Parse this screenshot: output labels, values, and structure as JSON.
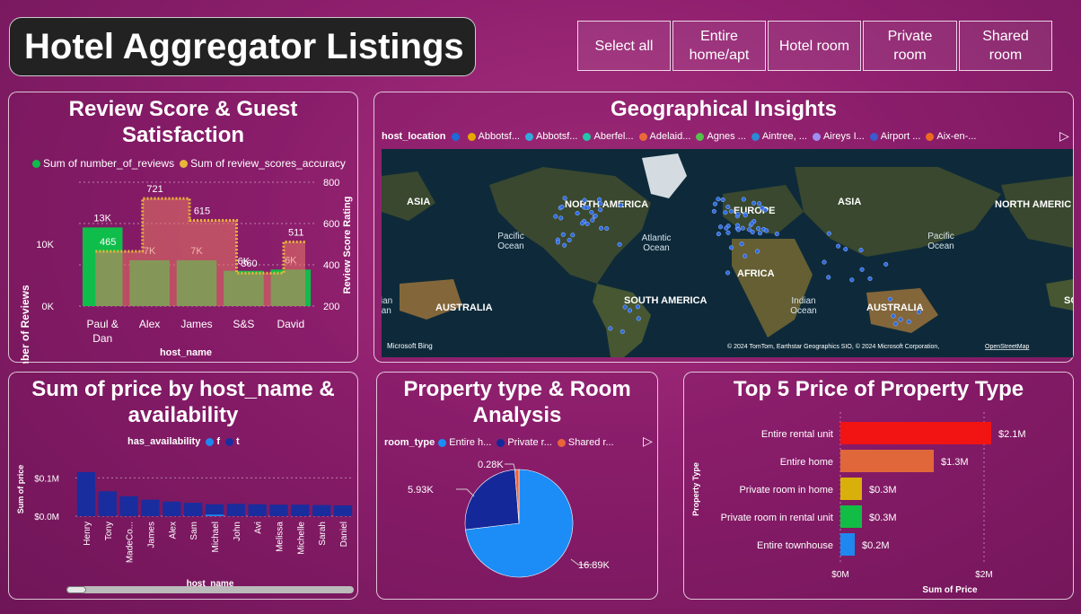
{
  "header": {
    "title": "Hotel Aggregator Listings"
  },
  "slicer": {
    "buttons": [
      "Select all",
      "Entire home/apt",
      "Hotel room",
      "Private room",
      "Shared room"
    ]
  },
  "review": {
    "title": "Review Score & Guest Satisfaction",
    "legend": [
      "Sum of number_of_reviews",
      "Sum of review_scores_accuracy"
    ],
    "ylabel_left": "Number of Reviews",
    "ylabel_right": "Review Score Rating",
    "xlabel": "host_name",
    "left_ticks": [
      "10K",
      "0K"
    ],
    "right_ticks": [
      "800",
      "600",
      "400",
      "200"
    ]
  },
  "geo": {
    "title": "Geographical Insights",
    "legend_label": "host_location",
    "legend_items": [
      "Abbotsf...",
      "Abbotsf...",
      "Aberfel...",
      "Adelaid...",
      "Agnes ...",
      "Aintree, ...",
      "Aireys I...",
      "Airport ...",
      "Aix-en-..."
    ],
    "legend_colors": [
      "#1e6ad8",
      "#e6a800",
      "#33aadd",
      "#22c5a8",
      "#e86a3a",
      "#55c04a",
      "#2a8ad6",
      "#9f8ff0",
      "#3c5acf",
      "#ef6a1e"
    ],
    "map_labels": {
      "asia_w": "ASIA",
      "north_america": "NORTH AMERICA",
      "europe": "EUROPE",
      "asia": "ASIA",
      "north_america_r": "NORTH AMERIC",
      "pacific_l": "Pacific\nOcean",
      "atlantic": "Atlantic\nOcean",
      "pacific_r": "Pacific\nOcean",
      "africa": "AFRICA",
      "south_america": "SOUTH AMERICA",
      "australia_l": "AUSTRALIA",
      "australia_r": "AUSTRALIA",
      "indian_l": "ndian\ncean",
      "indian": "Indian\nOcean",
      "so": "SO"
    },
    "bing": "Microsoft Bing",
    "copyright": "© 2024 TomTom, Earthstar Geographics SIO, © 2024 Microsoft Corporation,",
    "osm_link": "OpenStreetMap"
  },
  "price_host": {
    "title": "Sum of price by host_name & availability",
    "legend_label": "has_availability",
    "legend_items": [
      "f",
      "t"
    ],
    "ylabel": "Sum of price",
    "xlabel": "host_name",
    "yticks": [
      "$0.1M",
      "$0.0M"
    ]
  },
  "property": {
    "title": "Property type & Room Analysis",
    "legend_label": "room_type",
    "legend_items": [
      "Entire h...",
      "Private r...",
      "Shared r..."
    ],
    "labels": [
      "16.89K",
      "5.93K",
      "0.28K"
    ]
  },
  "top5": {
    "title": "Top 5 Price of Property Type",
    "ylabel": "Property Type",
    "xlabel": "Sum of Price",
    "xticks": [
      "$0M",
      "$2M"
    ]
  },
  "chart_data": [
    {
      "type": "bar",
      "title": "Review Score & Guest Satisfaction",
      "categories": [
        "Paul & Dan",
        "Alex",
        "James",
        "S&S",
        "David"
      ],
      "series": [
        {
          "name": "Sum of number_of_reviews",
          "values": [
            12700,
            7400,
            7400,
            5700,
            5900
          ],
          "labels": [
            "13K",
            "7K",
            "7K",
            "6K",
            "6K"
          ],
          "color": "#0fbd4a"
        },
        {
          "name": "Sum of review_scores_accuracy",
          "values": [
            465,
            721,
            615,
            360,
            511
          ],
          "color": "#e8b73a"
        }
      ],
      "xlabel": "host_name",
      "ylabel": "Number of Reviews",
      "y2label": "Review Score Rating",
      "ylim": [
        0,
        20000
      ],
      "y2lim": [
        200,
        800
      ]
    },
    {
      "type": "bar",
      "title": "Sum of price by host_name & availability",
      "categories": [
        "Henry",
        "Tony",
        "MadeCo...",
        "James",
        "Alex",
        "Sam",
        "Michael",
        "John",
        "Avi",
        "Melissa",
        "Michelle",
        "Sarah",
        "Daniel"
      ],
      "series": [
        {
          "name": "f",
          "values": [
            0,
            0,
            0,
            0,
            0,
            0,
            0.004,
            0,
            0,
            0,
            0,
            0,
            0
          ],
          "color": "#1e88f0"
        },
        {
          "name": "t",
          "values": [
            0.115,
            0.065,
            0.052,
            0.043,
            0.038,
            0.035,
            0.031,
            0.032,
            0.031,
            0.03,
            0.03,
            0.029,
            0.028
          ],
          "color": "#1a2d9e"
        }
      ],
      "xlabel": "host_name",
      "ylabel": "Sum of price",
      "ylim": [
        0,
        0.15
      ]
    },
    {
      "type": "pie",
      "title": "Property type & Room Analysis",
      "categories": [
        "Entire home/apt",
        "Private room",
        "Shared room"
      ],
      "values": [
        16890,
        5930,
        280
      ],
      "colors": [
        "#1c8cf7",
        "#15289a",
        "#e8643a"
      ]
    },
    {
      "type": "bar",
      "orientation": "horizontal",
      "title": "Top 5 Price of Property Type",
      "categories": [
        "Entire rental unit",
        "Entire home",
        "Private room in home",
        "Private room in rental unit",
        "Entire townhouse"
      ],
      "values": [
        2.1,
        1.3,
        0.3,
        0.3,
        0.2
      ],
      "labels": [
        "$2.1M",
        "$1.3M",
        "$0.3M",
        "$0.3M",
        "$0.2M"
      ],
      "colors": [
        "#f21313",
        "#e0673a",
        "#d9b00b",
        "#12bd45",
        "#1e88f0"
      ],
      "xlabel": "Sum of Price",
      "ylabel": "Property Type",
      "xlim": [
        0,
        2.5
      ]
    }
  ]
}
